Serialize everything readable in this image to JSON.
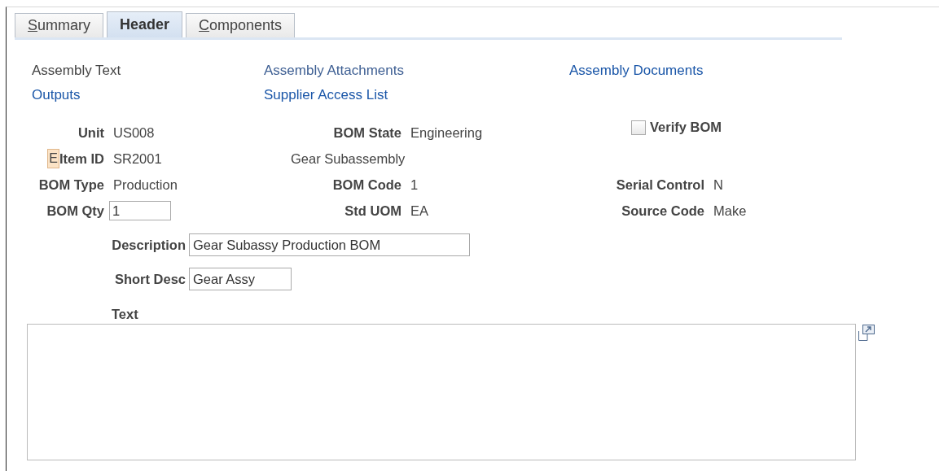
{
  "tabs": [
    {
      "label": "Summary",
      "selected": false,
      "access_key": true
    },
    {
      "label": "Header",
      "selected": true,
      "access_key": false
    },
    {
      "label": "Components",
      "selected": false,
      "access_key": true
    }
  ],
  "links": [
    {
      "items": [
        {
          "label": "Assembly Text",
          "kind": "text"
        },
        {
          "label": "Assembly Attachments",
          "kind": "visited"
        },
        {
          "label": "Assembly Documents",
          "kind": "link"
        }
      ]
    },
    {
      "items": [
        {
          "label": "Outputs",
          "kind": "link"
        },
        {
          "label": "Supplier Access List",
          "kind": "link"
        }
      ]
    }
  ],
  "fields": [
    {
      "cells": [
        {
          "kind": "display",
          "label": "Unit",
          "value": "US008"
        },
        {
          "kind": "display",
          "label": "BOM State",
          "value": "Engineering"
        },
        {
          "kind": "checkbox",
          "label": "Verify BOM",
          "checked": false
        }
      ]
    },
    {
      "cells": [
        {
          "kind": "display",
          "label": "Item ID",
          "value": "SR2001",
          "badge": "E"
        },
        {
          "kind": "note",
          "value": "Gear Subassembly"
        },
        {
          "kind": "empty"
        }
      ]
    },
    {
      "cells": [
        {
          "kind": "display",
          "label": "BOM Type",
          "value": "Production"
        },
        {
          "kind": "display",
          "label": "BOM Code",
          "value": "1"
        },
        {
          "kind": "display",
          "label": "Serial Control",
          "value": "N"
        }
      ]
    },
    {
      "cells": [
        {
          "kind": "input",
          "label": "BOM Qty",
          "value": "1"
        },
        {
          "kind": "display",
          "label": "Std UOM",
          "value": "EA"
        },
        {
          "kind": "display",
          "label": "Source Code",
          "value": "Make"
        }
      ]
    }
  ],
  "description": {
    "label": "Description",
    "value": "Gear Subassy Production BOM"
  },
  "short_desc": {
    "label": "Short Desc",
    "value": "Gear Assy"
  },
  "text": {
    "label": "Text"
  }
}
